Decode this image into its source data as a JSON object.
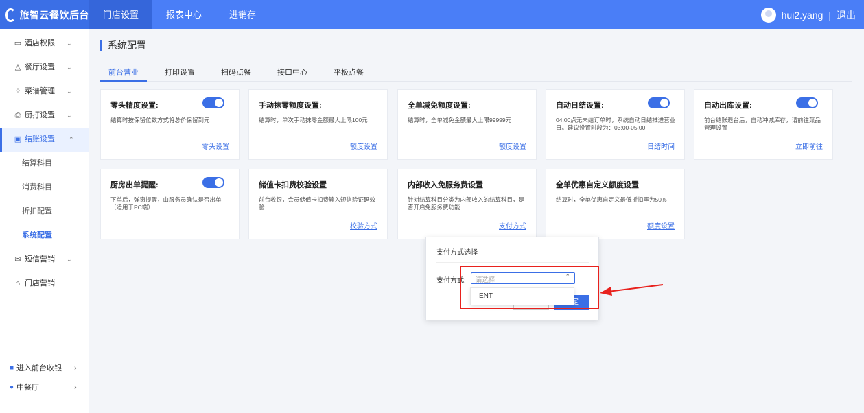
{
  "brand": {
    "name": "旅智云餐饮后台"
  },
  "nav": [
    {
      "label": "门店设置",
      "active": true
    },
    {
      "label": "报表中心",
      "active": false
    },
    {
      "label": "进销存",
      "active": false
    }
  ],
  "user": {
    "name": "hui2.yang",
    "separator": "|",
    "logout": "退出"
  },
  "sidebar": {
    "items": [
      {
        "label": "酒店权限",
        "icon": "hotel-icon"
      },
      {
        "label": "餐厅设置",
        "icon": "restaurant-icon"
      },
      {
        "label": "菜谱管理",
        "icon": "menu-icon"
      },
      {
        "label": "厨打设置",
        "icon": "printer-icon"
      },
      {
        "label": "结账设置",
        "icon": "checkout-icon",
        "active": true
      },
      {
        "label": "短信营销",
        "icon": "mail-icon"
      },
      {
        "label": "门店营销",
        "icon": "store-icon"
      }
    ],
    "sub_items": [
      {
        "label": "结算科目"
      },
      {
        "label": "消费科目"
      },
      {
        "label": "折扣配置"
      },
      {
        "label": "系统配置",
        "active": true
      }
    ],
    "bottom": [
      {
        "label": "进入前台收银",
        "icon": "cashier-icon"
      },
      {
        "label": "中餐厅",
        "icon": "location-pin-icon"
      }
    ]
  },
  "page": {
    "title": "系统配置"
  },
  "tabs": [
    {
      "label": "前台营业",
      "active": true
    },
    {
      "label": "打印设置"
    },
    {
      "label": "扫码点餐"
    },
    {
      "label": "接口中心"
    },
    {
      "label": "平板点餐"
    }
  ],
  "cards": [
    {
      "title": "零头精度设置:",
      "desc": "结算时按保留位数方式将总价保留到元",
      "link": "零头设置",
      "toggle": true
    },
    {
      "title": "手动抹零额度设置:",
      "desc": "结算时，单次手动抹零金额最大上限100元",
      "link": "额度设置",
      "toggle": false
    },
    {
      "title": "全单减免额度设置:",
      "desc": "结算时，全单减免金额最大上限99999元",
      "link": "额度设置",
      "toggle": false
    },
    {
      "title": "自动日结设置:",
      "desc": "04:00点无未结订单时，系统自动日结推进营业日。建议设置时段为：03:00-05:00",
      "link": "日结时间",
      "toggle": true
    },
    {
      "title": "自动出库设置:",
      "desc": "前台结账退台后，自动冲减库存，请前往菜品管理设置",
      "link": "立即前往",
      "toggle": true
    },
    {
      "title": "厨房出单提醒:",
      "desc": "下单后，弹窗提醒，由服务员确认是否出单（适用于PC端）",
      "link": "",
      "toggle": true
    },
    {
      "title": "储值卡扣费校验设置",
      "desc": "前台收银，会员储值卡扣费输入短信验证码效验",
      "link": "校验方式",
      "toggle": false
    },
    {
      "title": "内部收入免服务费设置",
      "desc": "针对结算科目分类为内部收入的结算科目，是否开启免服务费功能",
      "link": "支付方式",
      "toggle": false
    },
    {
      "title": "全单优惠自定义额度设置",
      "desc": "结算时，全单优惠自定义最低折扣率为50%",
      "link": "额度设置",
      "toggle": false
    }
  ],
  "dialog": {
    "title": "支付方式选择",
    "label": "支付方式:",
    "placeholder": "请选择",
    "options": [
      "ENT"
    ],
    "ok_label": "定"
  },
  "colors": {
    "primary": "#4a7ef7",
    "highlight": "#e8211d"
  }
}
